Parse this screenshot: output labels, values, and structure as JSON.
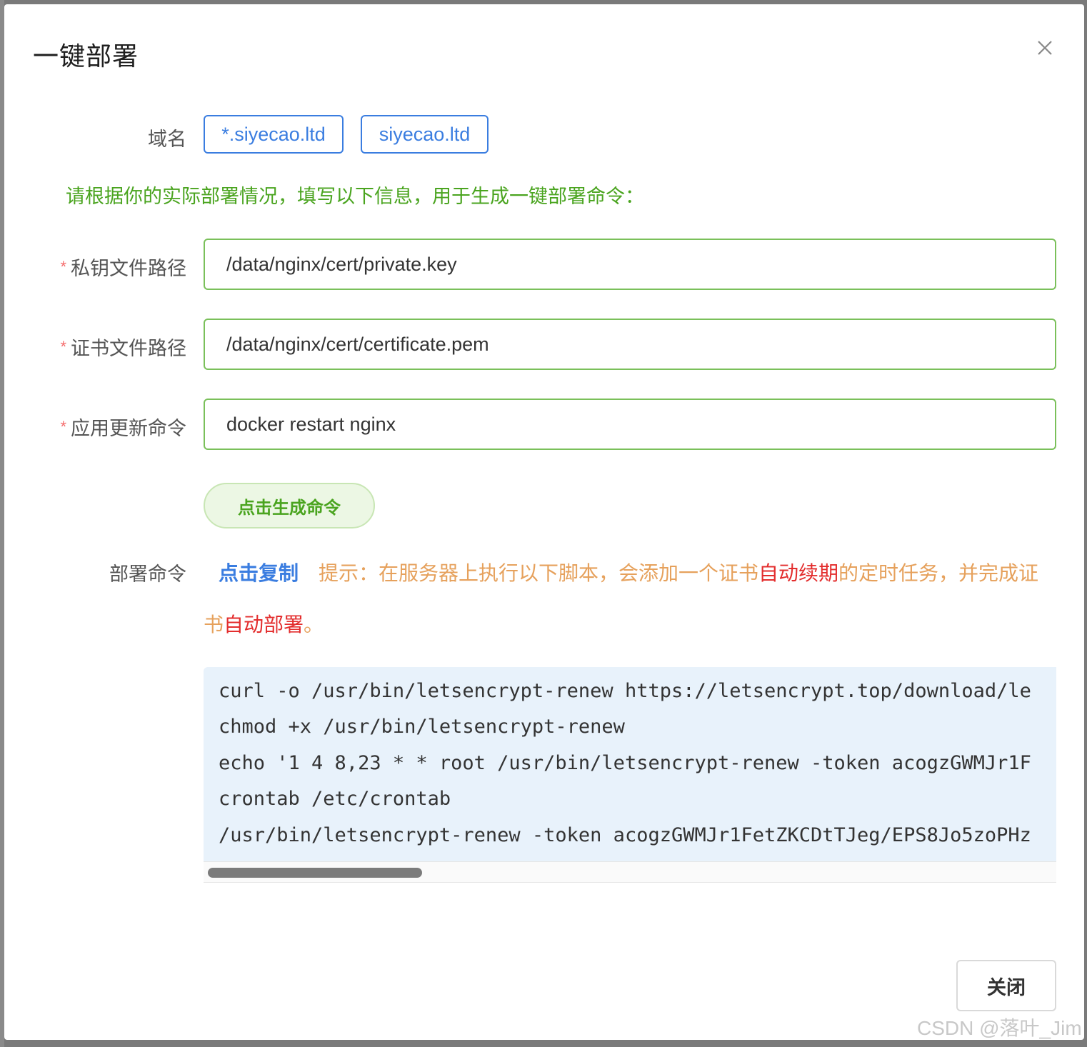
{
  "dialog": {
    "title": "一键部署",
    "close_icon": "close-icon"
  },
  "domain": {
    "label": "域名",
    "tags": [
      "*.siyecao.ltd",
      "siyecao.ltd"
    ]
  },
  "instruction": "请根据你的实际部署情况，填写以下信息，用于生成一键部署命令：",
  "fields": {
    "required_mark": "*",
    "private_key": {
      "label": "私钥文件路径",
      "value": "/data/nginx/cert/private.key"
    },
    "certificate": {
      "label": "证书文件路径",
      "value": "/data/nginx/cert/certificate.pem"
    },
    "update_cmd": {
      "label": "应用更新命令",
      "value": "docker restart nginx"
    }
  },
  "generate_button": "点击生成命令",
  "deploy": {
    "label": "部署命令",
    "copy_link": "点击复制",
    "tip_part1": "提示：在服务器上执行以下脚本，会添加一个证书",
    "tip_red1": "自动续期",
    "tip_part2": "的定时任务，并完成证",
    "tip_part3": "书",
    "tip_red2": "自动部署",
    "tip_part4": "。"
  },
  "code_lines": [
    "curl -o /usr/bin/letsencrypt-renew https://letsencrypt.top/download/le",
    "chmod +x /usr/bin/letsencrypt-renew",
    "echo '1 4 8,23 * * root /usr/bin/letsencrypt-renew -token acogzGWMJr1F",
    "crontab /etc/crontab",
    "/usr/bin/letsencrypt-renew -token acogzGWMJr1FetZKCDtTJeg/EPS8Jo5zoPHz"
  ],
  "close_button": "关闭",
  "watermark": "CSDN @落叶_Jim"
}
